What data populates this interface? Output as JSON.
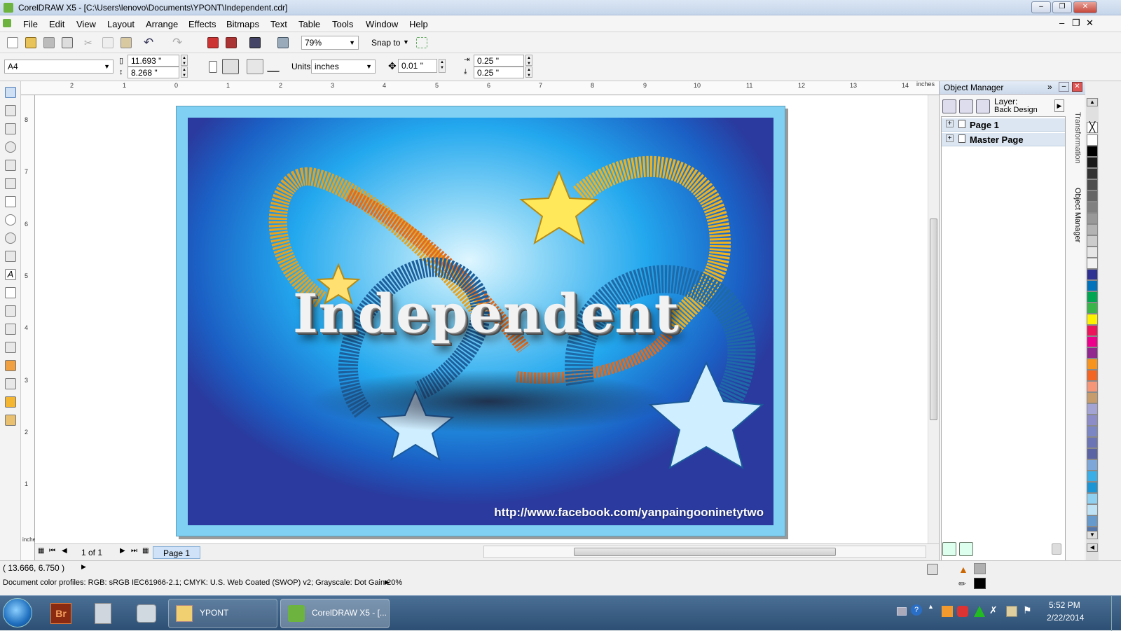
{
  "window": {
    "title": "CorelDRAW X5 - [C:\\Users\\lenovo\\Documents\\YPONT\\Independent.cdr]"
  },
  "menu": [
    "File",
    "Edit",
    "View",
    "Layout",
    "Arrange",
    "Effects",
    "Bitmaps",
    "Text",
    "Table",
    "Tools",
    "Window",
    "Help"
  ],
  "toolbar": {
    "zoom": "79%",
    "snap_to": "Snap to"
  },
  "property_bar": {
    "page_size": "A4",
    "width": "11.693 \"",
    "height": "8.268 \"",
    "units_label": "Units:",
    "units": "inches",
    "nudge": "0.01 \"",
    "dup_x": "0.25 \"",
    "dup_y": "0.25 \""
  },
  "ruler": {
    "unit": "inches",
    "top_ticks": [
      "2",
      "1",
      "0",
      "1",
      "2",
      "3",
      "4",
      "5",
      "6",
      "7",
      "8",
      "9",
      "10",
      "11",
      "12",
      "13",
      "14"
    ],
    "left_ticks": [
      "8",
      "7",
      "6",
      "5",
      "4",
      "3",
      "2",
      "1"
    ],
    "left_unit": "inches"
  },
  "artwork": {
    "headline": "Independent",
    "url": "http://www.facebook.com/yanpaingooninetytwo"
  },
  "page_nav": {
    "counter": "1 of 1",
    "tab": "Page 1"
  },
  "status": {
    "coords": "( 13.666, 6.750 )",
    "profiles": "Document color profiles: RGB: sRGB IEC61966-2.1; CMYK: U.S. Web Coated (SWOP) v2; Grayscale: Dot Gain 20%"
  },
  "object_manager": {
    "title": "Object Manager",
    "layer_label": "Layer:",
    "layer_name": "Back Design",
    "items": [
      "Page 1",
      "Master Page"
    ]
  },
  "docker_tabs": [
    "Transformation",
    "Object Manager"
  ],
  "palette": [
    "#ffffff",
    "#000000",
    "#1a1a1a",
    "#333333",
    "#4d4d4d",
    "#666666",
    "#808080",
    "#999999",
    "#b3b3b3",
    "#cccccc",
    "#e6e6e6",
    "#f2f2f2",
    "#2e3192",
    "#0072bc",
    "#00a651",
    "#39b54a",
    "#fff200",
    "#ed145b",
    "#ec008c",
    "#92278f",
    "#f7941d",
    "#f26522",
    "#f69679",
    "#c69c6d",
    "#a3a3d4",
    "#8c8cc8",
    "#7b86c4",
    "#6b74b4",
    "#5a63a4",
    "#7da7d9",
    "#3aaee6",
    "#1b95d4",
    "#8fd0f0",
    "#bfe3f5",
    "#6699cc",
    "#5577aa"
  ],
  "taskbar": {
    "items": [
      "YPONT",
      "CorelDRAW X5 - [..."
    ],
    "time": "5:52 PM",
    "date": "2/22/2014"
  }
}
